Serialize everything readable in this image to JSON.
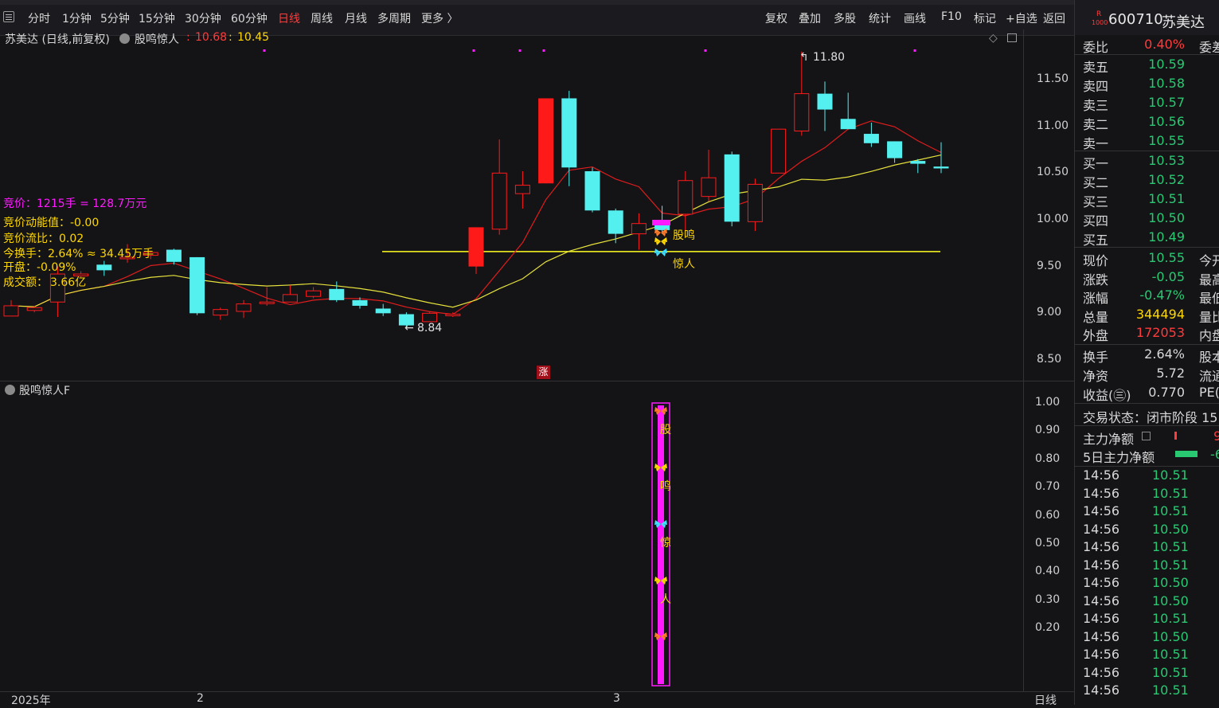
{
  "toolbar": {
    "periods": [
      "分时",
      "1分钟",
      "5分钟",
      "15分钟",
      "30分钟",
      "60分钟",
      "日线",
      "周线",
      "月线",
      "多周期",
      "更多 〉"
    ],
    "active_period": "日线",
    "right_tools": [
      "复权",
      "叠加",
      "多股",
      "统计",
      "画线",
      "F10",
      "标记",
      "+自选",
      "返回"
    ]
  },
  "chart_header": {
    "title": "苏美达 (日线,前复权)",
    "indicator": "股鸣惊人",
    "value1": "10.68",
    "value2": "10.45",
    "colors": {
      "value1": "#ff3b3b",
      "value2": "#ffd800"
    }
  },
  "info_lines": {
    "auction": "竞价：1215手 = 128.7万元",
    "auction_energy": "竞价动能值：-0.00",
    "auction_flow": "竞价流比：0.02",
    "turnover": "今换手：2.64%  ≈  34.45万手",
    "open": "开盘：-0.09%",
    "amount_label": "成交额：",
    "amount_value": "3.66亿"
  },
  "annotations": {
    "high": "11.80",
    "low": "8.84",
    "signal1": "股鸣",
    "signal2": "惊人",
    "zhang": "涨"
  },
  "chart_data": {
    "type": "candlestick",
    "y_axis_main": [
      "11.50",
      "11.00",
      "10.50",
      "10.00",
      "9.50",
      "9.00",
      "8.50"
    ],
    "candles": [
      {
        "o": 8.97,
        "c": 9.08,
        "h": 9.14,
        "l": 8.97
      },
      {
        "o": 9.03,
        "c": 9.06,
        "h": 9.08,
        "l": 9.01
      },
      {
        "o": 9.12,
        "c": 9.42,
        "h": 9.5,
        "l": 8.96
      },
      {
        "o": 9.4,
        "c": 9.42,
        "h": 9.45,
        "l": 9.38
      },
      {
        "o": 9.52,
        "c": 9.46,
        "h": 9.56,
        "l": 9.4
      },
      {
        "o": 9.6,
        "c": 9.6,
        "h": 9.74,
        "l": 9.54
      },
      {
        "o": 9.62,
        "c": 9.65,
        "h": 9.67,
        "l": 9.58
      },
      {
        "o": 9.68,
        "c": 9.55,
        "h": 9.69,
        "l": 9.52
      },
      {
        "o": 9.6,
        "c": 9.0,
        "h": 9.6,
        "l": 8.98
      },
      {
        "o": 8.98,
        "c": 9.04,
        "h": 9.06,
        "l": 8.93
      },
      {
        "o": 9.02,
        "c": 9.1,
        "h": 9.14,
        "l": 8.95
      },
      {
        "o": 9.12,
        "c": 9.12,
        "h": 9.28,
        "l": 9.08
      },
      {
        "o": 9.12,
        "c": 9.2,
        "h": 9.3,
        "l": 9.12
      },
      {
        "o": 9.18,
        "c": 9.24,
        "h": 9.28,
        "l": 9.16
      },
      {
        "o": 9.26,
        "c": 9.14,
        "h": 9.34,
        "l": 9.12
      },
      {
        "o": 9.14,
        "c": 9.08,
        "h": 9.17,
        "l": 9.05
      },
      {
        "o": 9.05,
        "c": 9.0,
        "h": 9.1,
        "l": 8.97
      },
      {
        "o": 8.99,
        "c": 8.87,
        "h": 9.01,
        "l": 8.84
      },
      {
        "o": 8.91,
        "c": 9.0,
        "h": 9.02,
        "l": 8.91
      },
      {
        "o": 8.98,
        "c": 8.99,
        "h": 9.01,
        "l": 8.96
      },
      {
        "o": 9.5,
        "c": 9.92,
        "h": 9.92,
        "l": 9.42
      },
      {
        "o": 9.9,
        "c": 10.5,
        "h": 10.86,
        "l": 9.84
      },
      {
        "o": 10.28,
        "c": 10.37,
        "h": 10.52,
        "l": 10.12
      },
      {
        "o": 10.39,
        "c": 11.3,
        "h": 11.3,
        "l": 10.39
      },
      {
        "o": 11.3,
        "c": 10.56,
        "h": 11.38,
        "l": 10.36
      },
      {
        "o": 10.52,
        "c": 10.1,
        "h": 10.56,
        "l": 10.08
      },
      {
        "o": 10.1,
        "c": 9.85,
        "h": 10.12,
        "l": 9.75
      },
      {
        "o": 9.85,
        "c": 9.96,
        "h": 10.07,
        "l": 9.68
      },
      {
        "o": 9.95,
        "c": 9.89,
        "h": 10.15,
        "l": 9.85
      },
      {
        "o": 10.06,
        "c": 10.42,
        "h": 10.52,
        "l": 9.88
      },
      {
        "o": 10.25,
        "c": 10.45,
        "h": 10.75,
        "l": 10.2
      },
      {
        "o": 10.7,
        "c": 9.98,
        "h": 10.73,
        "l": 9.93
      },
      {
        "o": 9.98,
        "c": 10.38,
        "h": 10.44,
        "l": 9.88
      },
      {
        "o": 10.5,
        "c": 10.97,
        "h": 10.97,
        "l": 10.5
      },
      {
        "o": 10.95,
        "c": 11.35,
        "h": 11.8,
        "l": 10.9
      },
      {
        "o": 11.35,
        "c": 11.18,
        "h": 11.48,
        "l": 10.95
      },
      {
        "o": 11.08,
        "c": 10.97,
        "h": 11.36,
        "l": 10.97
      },
      {
        "o": 10.92,
        "c": 10.82,
        "h": 11.04,
        "l": 10.78
      },
      {
        "o": 10.84,
        "c": 10.66,
        "h": 10.84,
        "l": 10.61
      },
      {
        "o": 10.63,
        "c": 10.6,
        "h": 10.65,
        "l": 10.5
      },
      {
        "o": 10.57,
        "c": 10.55,
        "h": 10.83,
        "l": 10.5
      }
    ],
    "hline": 9.66,
    "y_axis_sub": [
      "1.00",
      "0.90",
      "0.80",
      "0.70",
      "0.60",
      "0.50",
      "0.40",
      "0.30",
      "0.20"
    ],
    "sub_indicator": "股鸣惊人F",
    "sub_chars": [
      "股",
      "鸣",
      "惊",
      "人"
    ],
    "x_labels": [
      "2025年",
      "2",
      "3"
    ],
    "period_label": "日线",
    "colors": {
      "up": "#ff1a1a",
      "down": "#54f0f0",
      "ma_short": "#e01c1c",
      "ma_long": "#e6e13c",
      "signal": "#ff1aff",
      "hline": "#ffff22"
    }
  },
  "stock": {
    "code": "600710",
    "name": "苏美达",
    "badge_top": "R",
    "badge_bottom": "1000"
  },
  "quote": {
    "ratio_label": "委比",
    "ratio_value": "0.40%",
    "ratio_right": "委差",
    "asks": [
      {
        "k": "卖五",
        "v": "10.59"
      },
      {
        "k": "卖四",
        "v": "10.58"
      },
      {
        "k": "卖三",
        "v": "10.57"
      },
      {
        "k": "卖二",
        "v": "10.56"
      },
      {
        "k": "卖一",
        "v": "10.55"
      }
    ],
    "bids": [
      {
        "k": "买一",
        "v": "10.53"
      },
      {
        "k": "买二",
        "v": "10.52"
      },
      {
        "k": "买三",
        "v": "10.51"
      },
      {
        "k": "买四",
        "v": "10.50"
      },
      {
        "k": "买五",
        "v": "10.49"
      }
    ],
    "stats": [
      {
        "k": "现价",
        "v": "10.55",
        "c": "#29c972",
        "k2": "今开"
      },
      {
        "k": "涨跌",
        "v": "-0.05",
        "c": "#29c972",
        "k2": "最高"
      },
      {
        "k": "涨幅",
        "v": "-0.47%",
        "c": "#29c972",
        "k2": "最低"
      },
      {
        "k": "总量",
        "v": "344494",
        "c": "#ffd800",
        "k2": "量比"
      },
      {
        "k": "外盘",
        "v": "172053",
        "c": "#ff3b3b",
        "k2": "内盘"
      }
    ],
    "stats2": [
      {
        "k": "换手",
        "v": "2.64%",
        "c": "#d8d8d8",
        "k2": "股本"
      },
      {
        "k": "净资",
        "v": "5.72",
        "c": "#d8d8d8",
        "k2": "流通"
      },
      {
        "k": "收益(㊂)",
        "v": "0.770",
        "c": "#d8d8d8",
        "k2": "PE("
      }
    ],
    "trade_state": "交易状态：闭市阶段 15",
    "main_net_label": "主力净额",
    "main_net_value": "9",
    "main5_label": "5日主力净额",
    "main5_value": "-6"
  },
  "ticks": [
    {
      "t": "14:56",
      "p": "10.51"
    },
    {
      "t": "14:56",
      "p": "10.51"
    },
    {
      "t": "14:56",
      "p": "10.51"
    },
    {
      "t": "14:56",
      "p": "10.50"
    },
    {
      "t": "14:56",
      "p": "10.51"
    },
    {
      "t": "14:56",
      "p": "10.51"
    },
    {
      "t": "14:56",
      "p": "10.50"
    },
    {
      "t": "14:56",
      "p": "10.50"
    },
    {
      "t": "14:56",
      "p": "10.51"
    },
    {
      "t": "14:56",
      "p": "10.50"
    },
    {
      "t": "14:56",
      "p": "10.51"
    },
    {
      "t": "14:56",
      "p": "10.51"
    },
    {
      "t": "14:56",
      "p": "10.51"
    }
  ]
}
